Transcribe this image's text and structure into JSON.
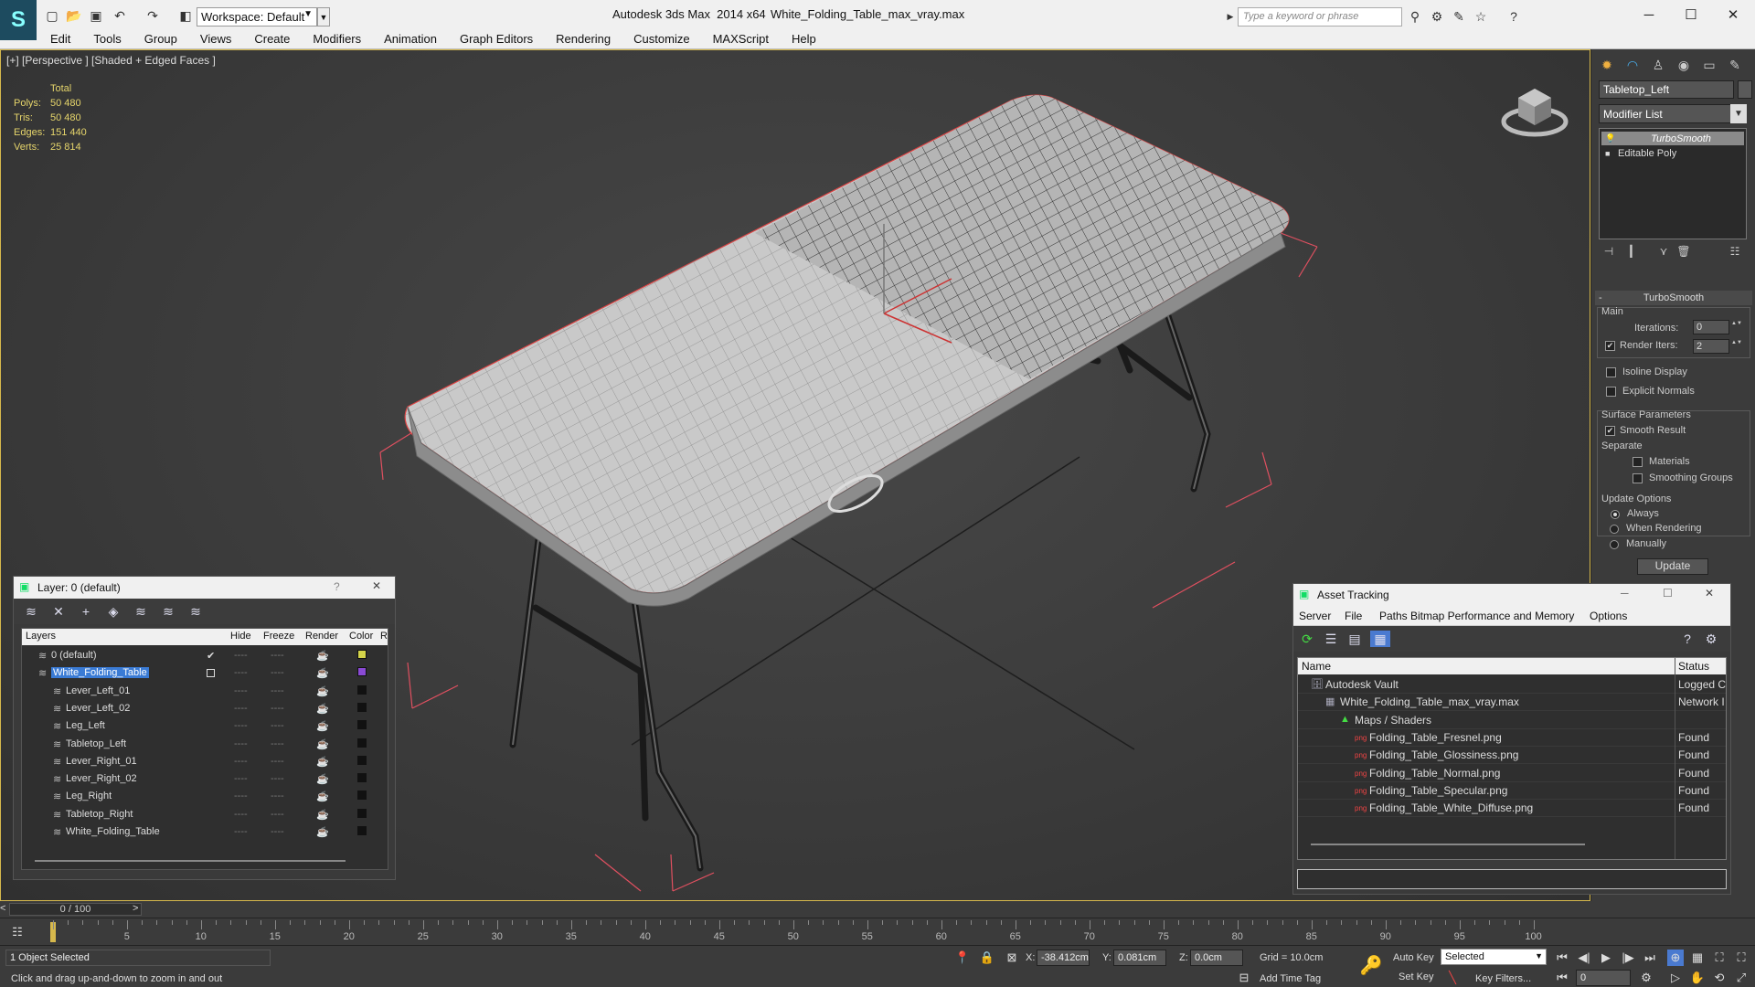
{
  "titlebar": {
    "workspace": "Workspace: Default",
    "app": "Autodesk 3ds Max  2014 x64",
    "file": "White_Folding_Table_max_vray.max",
    "search_placeholder": "Type a keyword or phrase"
  },
  "menu": [
    "Edit",
    "Tools",
    "Group",
    "Views",
    "Create",
    "Modifiers",
    "Animation",
    "Graph Editors",
    "Rendering",
    "Customize",
    "MAXScript",
    "Help"
  ],
  "viewport": {
    "label": "[+] [Perspective ] [Shaded + Edged Faces ]",
    "stats": {
      "header": "Total",
      "rows": [
        {
          "k": "Polys:",
          "v": "50 480"
        },
        {
          "k": "Tris:",
          "v": "50 480"
        },
        {
          "k": "Edges:",
          "v": "151 440"
        },
        {
          "k": "Verts:",
          "v": "25 814"
        }
      ]
    }
  },
  "command_panel": {
    "object_name": "Tabletop_Left",
    "modifier_list": "Modifier List",
    "stack": [
      "TurboSmooth",
      "Editable Poly"
    ],
    "rollout": "TurboSmooth",
    "main_label": "Main",
    "iterations_label": "Iterations:",
    "iterations": "0",
    "render_iters_label": "Render Iters:",
    "render_iters": "2",
    "isoline": "Isoline Display",
    "explicit": "Explicit Normals",
    "surface": "Surface Parameters",
    "smooth_result": "Smooth Result",
    "separate": "Separate",
    "materials": "Materials",
    "smoothing_groups": "Smoothing Groups",
    "update_options": "Update Options",
    "always": "Always",
    "when_rendering": "When Rendering",
    "manually": "Manually",
    "update_btn": "Update"
  },
  "layer_window": {
    "title": "Layer: 0 (default)",
    "help": "?",
    "columns": {
      "layers": "Layers",
      "hide": "Hide",
      "freeze": "Freeze",
      "render": "Render",
      "color": "Color",
      "r": "R"
    },
    "rows": [
      {
        "name": "0 (default)",
        "level": 0,
        "color": "#d4d44a",
        "check": "✔"
      },
      {
        "name": "White_Folding_Table",
        "level": 0,
        "color": "#8a4ad4",
        "selected": true
      },
      {
        "name": "Lever_Left_01",
        "level": 1,
        "color": "#111111"
      },
      {
        "name": "Lever_Left_02",
        "level": 1,
        "color": "#111111"
      },
      {
        "name": "Leg_Left",
        "level": 1,
        "color": "#111111"
      },
      {
        "name": "Tabletop_Left",
        "level": 1,
        "color": "#111111"
      },
      {
        "name": "Lever_Right_01",
        "level": 1,
        "color": "#111111"
      },
      {
        "name": "Lever_Right_02",
        "level": 1,
        "color": "#111111"
      },
      {
        "name": "Leg_Right",
        "level": 1,
        "color": "#111111"
      },
      {
        "name": "Tabletop_Right",
        "level": 1,
        "color": "#111111"
      },
      {
        "name": "White_Folding_Table",
        "level": 1,
        "color": "#111111"
      }
    ]
  },
  "asset_window": {
    "title": "Asset Tracking",
    "menu": [
      "Server",
      "File",
      "Paths",
      "Bitmap Performance and Memory",
      "Options"
    ],
    "columns": {
      "name": "Name",
      "status": "Status"
    },
    "rows": [
      {
        "name": "Autodesk Vault",
        "status": "Logged C",
        "indent": 0
      },
      {
        "name": "White_Folding_Table_max_vray.max",
        "status": "Network I",
        "indent": 1
      },
      {
        "name": "Maps / Shaders",
        "status": "",
        "indent": 2
      },
      {
        "name": "Folding_Table_Fresnel.png",
        "status": "Found",
        "indent": 3
      },
      {
        "name": "Folding_Table_Glossiness.png",
        "status": "Found",
        "indent": 3
      },
      {
        "name": "Folding_Table_Normal.png",
        "status": "Found",
        "indent": 3
      },
      {
        "name": "Folding_Table_Specular.png",
        "status": "Found",
        "indent": 3
      },
      {
        "name": "Folding_Table_White_Diffuse.png",
        "status": "Found",
        "indent": 3
      }
    ]
  },
  "timeline": {
    "frame": "0 / 100",
    "ticks": [
      "0",
      "5",
      "10",
      "15",
      "20",
      "25",
      "30",
      "35",
      "40",
      "45",
      "50",
      "55",
      "60",
      "65",
      "70",
      "75",
      "80",
      "85",
      "90",
      "95",
      "100"
    ]
  },
  "status": {
    "selected": "1 Object Selected",
    "prompt": "Click and drag up-and-down to zoom in and out",
    "x_label": "X:",
    "x": "-38.412cm",
    "y_label": "Y:",
    "y": "0.081cm",
    "z_label": "Z:",
    "z": "0.0cm",
    "grid": "Grid = 10.0cm",
    "auto_key": "Auto Key",
    "set_key": "Set Key",
    "selected_set": "Selected",
    "key_filters": "Key Filters...",
    "add_time_tag": "Add Time Tag",
    "frame_field": "0"
  }
}
